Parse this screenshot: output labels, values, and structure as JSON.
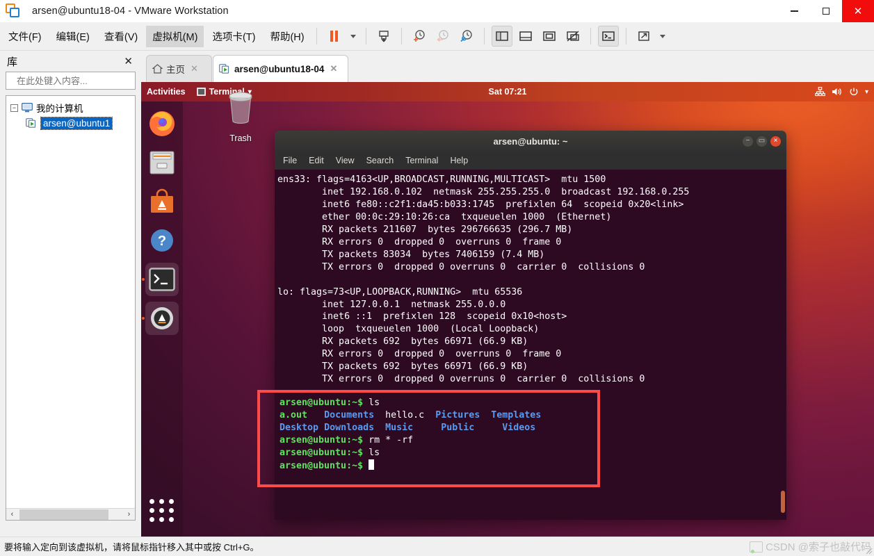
{
  "window": {
    "title": "arsen@ubuntu18-04 - VMware Workstation",
    "logo_icon": "vmware-logo-icon",
    "controls": {
      "minimize": "minimize-icon",
      "maximize": "maximize-icon",
      "close": "close-icon"
    }
  },
  "menubar": {
    "items": [
      {
        "label": "文件(F)",
        "name": "menu-file",
        "active": false
      },
      {
        "label": "编辑(E)",
        "name": "menu-edit",
        "active": false
      },
      {
        "label": "查看(V)",
        "name": "menu-view",
        "active": false
      },
      {
        "label": "虚拟机(M)",
        "name": "menu-virtual-machine",
        "active": true
      },
      {
        "label": "选项卡(T)",
        "name": "menu-tabs",
        "active": false
      },
      {
        "label": "帮助(H)",
        "name": "menu-help",
        "active": false
      }
    ],
    "toolbar": [
      {
        "name": "suspend-button",
        "icon": "pause-icon"
      },
      {
        "name": "suspend-dropdown",
        "icon": "chevron-down-icon"
      },
      {
        "name": "power-button",
        "icon": "power-on-icon"
      },
      {
        "name": "snapshot-take-button",
        "icon": "snapshot-add-icon"
      },
      {
        "name": "snapshot-revert-button",
        "icon": "snapshot-revert-icon"
      },
      {
        "name": "snapshot-manager-button",
        "icon": "snapshot-manager-icon"
      },
      {
        "name": "show-library-button",
        "icon": "sidebar-panel-icon"
      },
      {
        "name": "show-thumbnail-bar-button",
        "icon": "bottom-panel-icon"
      },
      {
        "name": "fullscreen-button",
        "icon": "fullscreen-icon"
      },
      {
        "name": "unity-mode-button",
        "icon": "unity-mode-icon"
      },
      {
        "name": "console-button",
        "icon": "console-icon"
      },
      {
        "name": "stretch-button",
        "icon": "stretch-icon"
      },
      {
        "name": "stretch-dropdown",
        "icon": "chevron-down-icon"
      }
    ]
  },
  "library": {
    "title": "库",
    "close_icon": "close-icon",
    "search": {
      "placeholder": "在此处键入内容...",
      "value": "",
      "icon": "search-icon",
      "dropdown_icon": "chevron-down-icon"
    },
    "tree": {
      "root": {
        "label": "我的计算机",
        "icon": "my-computer-icon",
        "expander": "−"
      },
      "children": [
        {
          "label": "arsen@ubuntu1",
          "icon": "vm-running-icon",
          "selected": true
        }
      ]
    },
    "hscroll": {
      "left_arrow": "‹",
      "right_arrow": "›"
    }
  },
  "tabs": [
    {
      "label": "主页",
      "icon": "home-icon",
      "close_icon": "close-icon",
      "active": false,
      "name": "tab-home"
    },
    {
      "label": "arsen@ubuntu18-04",
      "icon": "vm-running-icon",
      "close_icon": "close-icon",
      "active": true,
      "name": "tab-vm"
    }
  ],
  "ubuntu": {
    "topbar": {
      "activities": "Activities",
      "app_menu": {
        "label": "Terminal",
        "icon": "terminal-icon",
        "arrow": "▾"
      },
      "clock": "Sat 07:21",
      "tray": [
        {
          "name": "network-icon",
          "glyph": "network"
        },
        {
          "name": "volume-icon",
          "glyph": "volume"
        },
        {
          "name": "power-icon",
          "glyph": "power"
        },
        {
          "name": "system-menu-arrow-icon",
          "glyph": "▾"
        }
      ]
    },
    "dock": [
      {
        "name": "dock-item-firefox",
        "icon": "firefox-icon",
        "running": false
      },
      {
        "name": "dock-item-files",
        "icon": "files-icon",
        "running": false
      },
      {
        "name": "dock-item-software",
        "icon": "ubuntu-software-icon",
        "running": false
      },
      {
        "name": "dock-item-help",
        "icon": "help-icon",
        "running": false
      },
      {
        "name": "dock-item-terminal",
        "icon": "terminal-icon",
        "running": true
      },
      {
        "name": "dock-item-software-updater",
        "icon": "software-updater-icon",
        "running": true
      }
    ],
    "show_apps_label": "Show Applications",
    "desktop_icons": [
      {
        "label": "Trash",
        "icon": "trash-icon",
        "name": "desktop-icon-trash"
      }
    ]
  },
  "terminal": {
    "title": "arsen@ubuntu: ~",
    "window_buttons": {
      "minimize": "−",
      "maximize": "▭",
      "close": "×"
    },
    "menu": [
      "File",
      "Edit",
      "View",
      "Search",
      "Terminal",
      "Help"
    ],
    "output": "ens33: flags=4163<UP,BROADCAST,RUNNING,MULTICAST>  mtu 1500\n        inet 192.168.0.102  netmask 255.255.255.0  broadcast 192.168.0.255\n        inet6 fe80::c2f1:da45:b033:1745  prefixlen 64  scopeid 0x20<link>\n        ether 00:0c:29:10:26:ca  txqueuelen 1000  (Ethernet)\n        RX packets 211607  bytes 296766635 (296.7 MB)\n        RX errors 0  dropped 0  overruns 0  frame 0\n        TX packets 83034  bytes 7406159 (7.4 MB)\n        TX errors 0  dropped 0 overruns 0  carrier 0  collisions 0\n\nlo: flags=73<UP,LOOPBACK,RUNNING>  mtu 65536\n        inet 127.0.0.1  netmask 255.0.0.0\n        inet6 ::1  prefixlen 128  scopeid 0x10<host>\n        loop  txqueuelen 1000  (Local Loopback)\n        RX packets 692  bytes 66971 (66.9 KB)\n        RX errors 0  dropped 0  overruns 0  frame 0\n        TX packets 692  bytes 66971 (66.9 KB)\n        TX errors 0  dropped 0 overruns 0  carrier 0  collisions 0\n",
    "highlight": {
      "prompt": "arsen@ubuntu:~$",
      "lines": [
        {
          "type": "command",
          "prompt": "arsen@ubuntu:~$",
          "command": " ls"
        },
        {
          "type": "listing",
          "items": [
            "a.out",
            "Documents",
            "hello.c",
            "Pictures",
            "Templates"
          ]
        },
        {
          "type": "listing",
          "items": [
            "Desktop",
            "Downloads",
            "Music",
            "Public",
            "Videos"
          ]
        },
        {
          "type": "command",
          "prompt": "arsen@ubuntu:~$",
          "command": " rm * -rf"
        },
        {
          "type": "command",
          "prompt": "arsen@ubuntu:~$",
          "command": " ls"
        },
        {
          "type": "cursor",
          "prompt": "arsen@ubuntu:~$",
          "command": " "
        }
      ],
      "border_color": "#ff4a4a"
    },
    "colors": {
      "background": "#2d0922",
      "prompt_green": "#5fe35f",
      "dir_blue": "#5a9bf0",
      "text_white": "#ffffff"
    }
  },
  "statusbar": {
    "message": "要将输入定向到该虚拟机，请将鼠标指针移入其中或按 Ctrl+G。",
    "watermark": "CSDN @索子也敲代码"
  }
}
